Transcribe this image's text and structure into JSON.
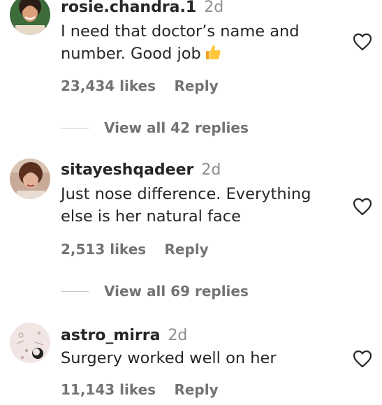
{
  "comments": [
    {
      "username": "rosie.chandra.1",
      "time": "2d",
      "text": "I need that doctor’s name and number. Good job",
      "emoji": "thumbs-up",
      "likes": "23,434 likes",
      "reply_label": "Reply",
      "view_replies": "View all 42 replies"
    },
    {
      "username": "sitayeshqadeer",
      "time": "2d",
      "text": "Just nose difference. Everything else is her natural face",
      "likes": "2,513 likes",
      "reply_label": "Reply",
      "view_replies": "View all 69 replies"
    },
    {
      "username": "astro_mirra",
      "time": "2d",
      "text": "Surgery worked well on her",
      "likes": "11,143 likes",
      "reply_label": "Reply"
    }
  ],
  "icons": {
    "like": "heart-outline-icon",
    "emoji": "thumbs-up-emoji"
  },
  "colors": {
    "text": "#262626",
    "secondary": "#737373",
    "divider": "#c7c7c7"
  }
}
